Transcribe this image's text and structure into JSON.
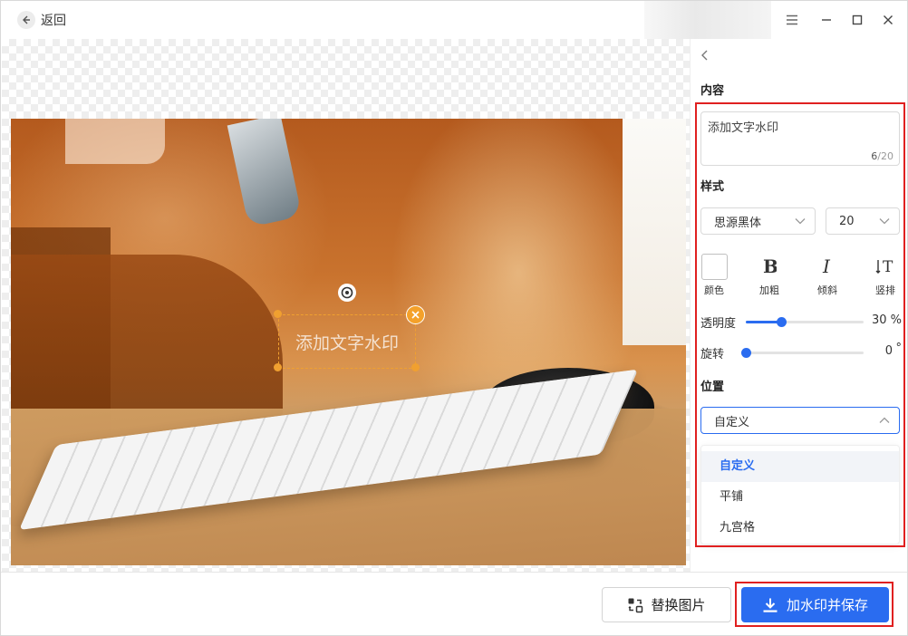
{
  "header": {
    "back_label": "返回"
  },
  "watermark": {
    "text": "添加文字水印"
  },
  "panel": {
    "content_title": "内容",
    "text_value": "添加文字水印",
    "char_count": "6",
    "char_max": "/20",
    "style_title": "样式",
    "font_family": "思源黑体",
    "font_size": "20",
    "tools": {
      "color": "颜色",
      "bold": "加粗",
      "italic": "倾斜",
      "vertical": "竖排"
    },
    "opacity_label": "透明度",
    "opacity_value": "30 %",
    "opacity_fraction": 0.3,
    "rotate_label": "旋转",
    "rotate_value": "0",
    "rotate_unit": "°",
    "rotate_fraction": 0.0,
    "position_title": "位置",
    "position_selected": "自定义",
    "position_options": [
      "自定义",
      "平铺",
      "九宫格"
    ]
  },
  "footer": {
    "replace_label": "替换图片",
    "save_label": "加水印并保存"
  },
  "colors": {
    "accent": "#2a6cf0",
    "highlight": "#e02020",
    "watermark_frame": "#f0a030"
  }
}
